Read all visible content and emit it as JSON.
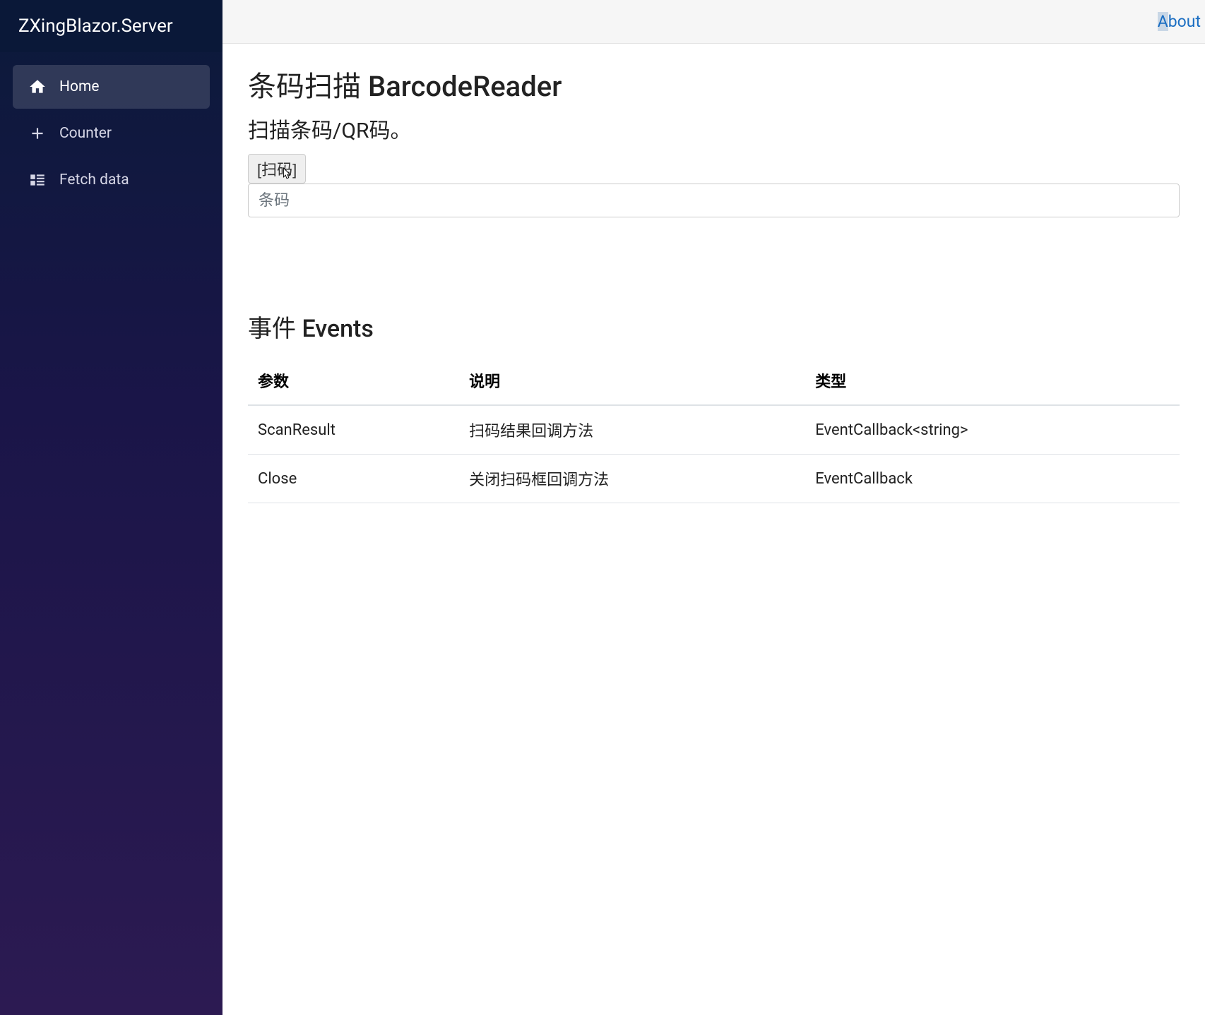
{
  "app": {
    "title": "ZXingBlazor.Server"
  },
  "sidebar": {
    "items": [
      {
        "label": "Home",
        "icon": "home",
        "active": true
      },
      {
        "label": "Counter",
        "icon": "plus",
        "active": false
      },
      {
        "label": "Fetch data",
        "icon": "list",
        "active": false
      }
    ]
  },
  "topbar": {
    "about_label": "About"
  },
  "page": {
    "title": "条码扫描 BarcodeReader",
    "subtitle": "扫描条码/QR码。",
    "scan_button": "[扫码]",
    "input_placeholder": "条码"
  },
  "events": {
    "heading": "事件 Events",
    "columns": [
      "参数",
      "说明",
      "类型"
    ],
    "rows": [
      {
        "param": "ScanResult",
        "desc": "扫码结果回调方法",
        "type": "EventCallback<string>"
      },
      {
        "param": "Close",
        "desc": "关闭扫码框回调方法",
        "type": "EventCallback"
      }
    ]
  }
}
